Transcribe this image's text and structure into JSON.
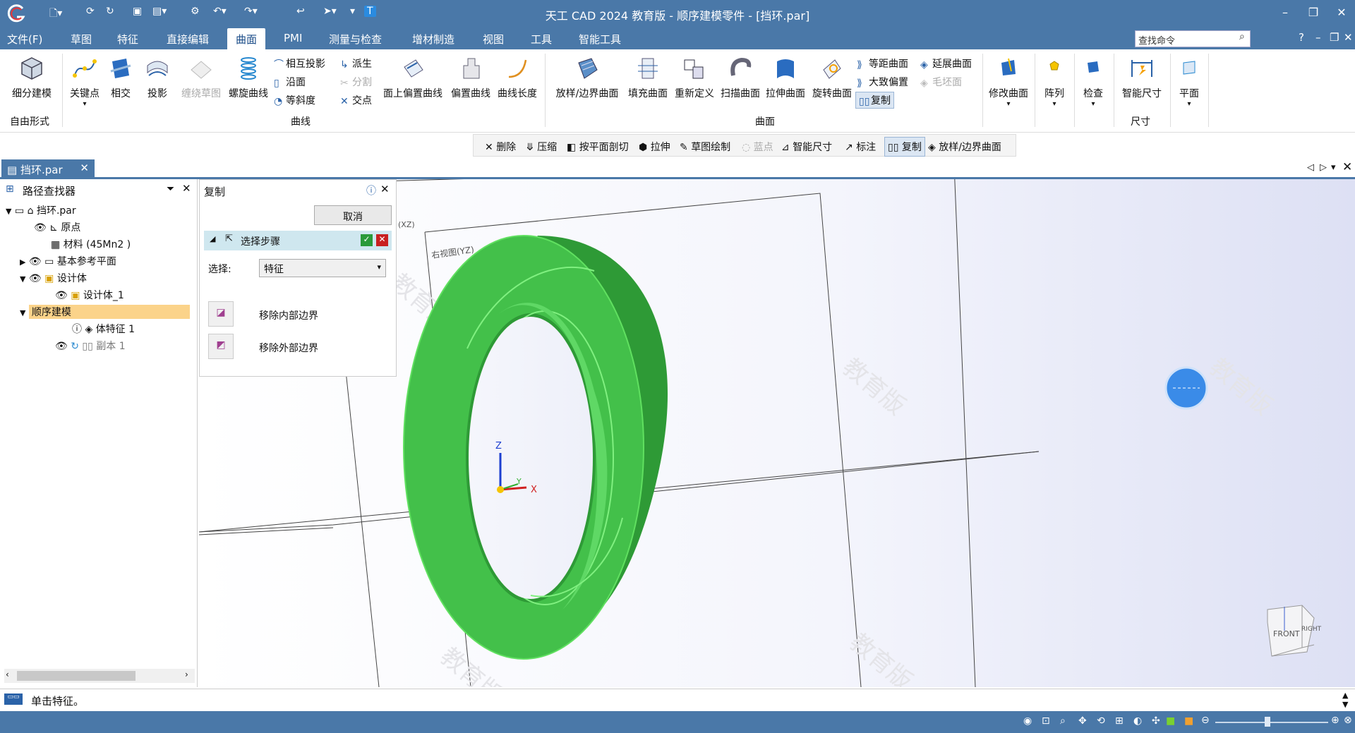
{
  "app": {
    "title": "天工 CAD 2024 教育版 - 顺序建模零件 - [挡环.par]"
  },
  "menu": {
    "items": [
      "文件(F)",
      "草图",
      "特征",
      "直接编辑",
      "曲面",
      "PMI",
      "测量与检查",
      "增材制造",
      "视图",
      "工具",
      "智能工具"
    ],
    "active": "曲面",
    "search_placeholder": "查找命令"
  },
  "ribbon": {
    "free_form": {
      "btn": "细分建模",
      "group": "自由形式"
    },
    "curve": {
      "keypoint": "关键点",
      "intersect": "相交",
      "project": "投影",
      "wrap_sketch": "缠绕草图",
      "helix": "螺旋曲线",
      "mutual_project": "相互投影",
      "along": "沿面",
      "isocline": "等斜度",
      "derive": "派生",
      "split": "分割",
      "intersection": "交点",
      "offset_on_face": "面上偏置曲线",
      "offset_curve": "偏置曲线",
      "curve_length": "曲线长度",
      "group": "曲线"
    },
    "surface": {
      "loft": "放样/边界曲面",
      "fill": "填充曲面",
      "redefine": "重新定义",
      "sweep": "扫描曲面",
      "extrude": "拉伸曲面",
      "revolve": "旋转曲面",
      "equidistant": "等距曲面",
      "extend": "延展曲面",
      "rough_offset": "大致偏置",
      "blank": "毛坯面",
      "copy": "复制",
      "group": "曲面"
    },
    "modify": "修改曲面",
    "pattern": "阵列",
    "inspect": "检查",
    "smart_dim": "智能尺寸",
    "dim_group": "尺寸",
    "plane": "平面"
  },
  "command_bar": [
    "删除",
    "压缩",
    "按平面剖切",
    "拉伸",
    "草图绘制",
    "蓝点",
    "智能尺寸",
    "标注",
    "复制",
    "放样/边界曲面"
  ],
  "doc_tab": "挡环.par",
  "pathfinder": {
    "title": "路径查找器",
    "root": "挡环.par",
    "origin": "原点",
    "material": "材料 (45Mn2 )",
    "base_planes": "基本参考平面",
    "design_body": "设计体",
    "design_body_1": "设计体_1",
    "sequential": "顺序建模",
    "body_feature": "体特征 1",
    "copy_1": "副本 1"
  },
  "copy_panel": {
    "title": "复制",
    "cancel": "取消",
    "step": "选择步骤",
    "select_label": "选择:",
    "select_value": "特征",
    "remove_inner": "移除内部边界",
    "remove_outer": "移除外部边界"
  },
  "viewport": {
    "plane_xz": "(XZ)",
    "plane_right": "右视图(YZ)",
    "watermark": "教育版",
    "axis_z": "Z",
    "axis_x": "X",
    "axis_y": "Y",
    "cube_front": "FRONT",
    "cube_right": "RIGHT"
  },
  "status": {
    "prompt": "单击特征。"
  },
  "colors": {
    "title_bg": "#4a78a8",
    "ring": "#43c04a",
    "ring_dark": "#2e9a36",
    "highlight": "#fbd38a"
  }
}
